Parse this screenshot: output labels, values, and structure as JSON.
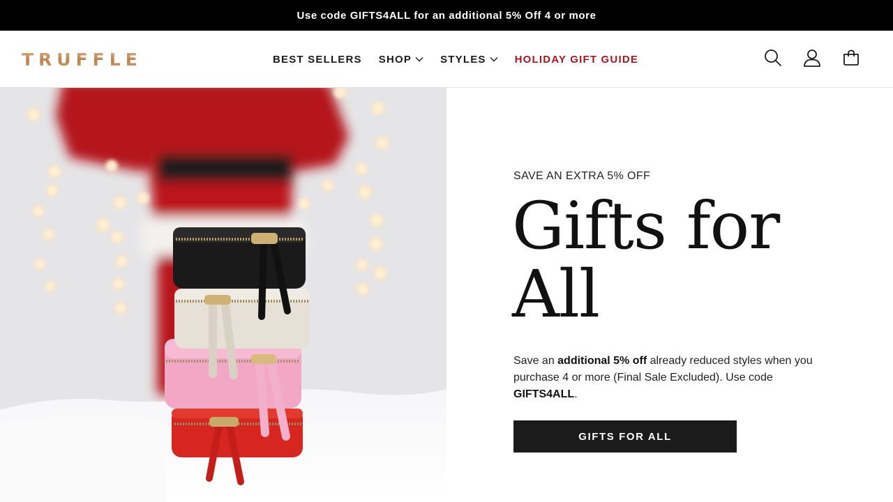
{
  "announcement": {
    "text": "Use code GIFTS4ALL for an additional 5% Off 4 or more"
  },
  "brand": {
    "logo_text": "TRUFFLE"
  },
  "nav": {
    "items": [
      {
        "label": "BEST SELLERS",
        "has_dropdown": false
      },
      {
        "label": "SHOP",
        "has_dropdown": true
      },
      {
        "label": "STYLES",
        "has_dropdown": true
      },
      {
        "label": "HOLIDAY GIFT GUIDE",
        "has_dropdown": false,
        "color": "#a21721"
      }
    ]
  },
  "header_icons": [
    "search-icon",
    "account-icon",
    "cart-icon"
  ],
  "hero": {
    "eyebrow": "SAVE AN EXTRA 5% OFF",
    "headline_line1": "Gifts for",
    "headline_line2": "All",
    "body_part1": "Save an ",
    "body_bold1": "additional 5% off",
    "body_part2": " already reduced styles when you purchase 4 or more (Final Sale Excluded). Use code ",
    "body_bold2": "GIFTS4ALL",
    "body_part3": ".",
    "cta_label": "GIFTS FOR ALL"
  },
  "colors": {
    "announcement_bg": "#000000",
    "accent": "#a21721",
    "button_bg": "#1b1b1b",
    "logo": "#c8956a"
  }
}
